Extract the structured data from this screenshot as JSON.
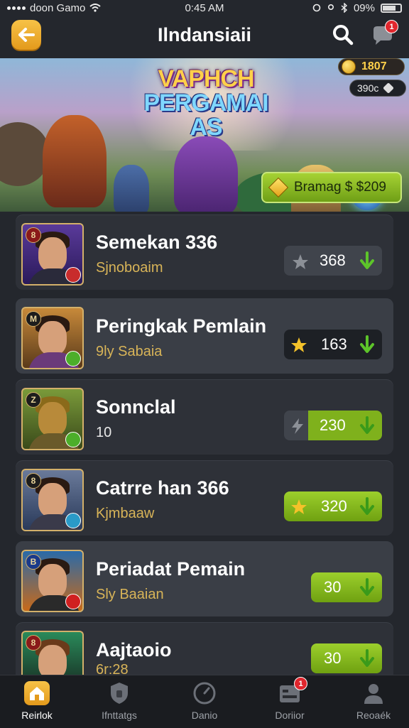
{
  "status": {
    "carrier": "doon Gamo",
    "time": "0:45 AM",
    "battery": "09%"
  },
  "header": {
    "title": "Ilndansiaii",
    "chat_badge": "1"
  },
  "banner": {
    "title_line1": "VAPHCH",
    "title_line2": "PERGAMAI AS",
    "coins": "1807",
    "gems": "390c",
    "buy_label": "Bramag $ $209"
  },
  "list": [
    {
      "rank": "8",
      "name": "Semekan 336",
      "sub": "Sjnoboaim",
      "score": "368",
      "star": "gray-star",
      "style": "gray"
    },
    {
      "rank": "M",
      "name": "Peringkak Pemlain",
      "sub": "9ly Sabaia",
      "score": "163",
      "star": "gold-star",
      "style": "dark"
    },
    {
      "rank": "Z",
      "name": "Sonnclal",
      "sub": "10",
      "score": "230",
      "star": "bolt",
      "style": "green-split"
    },
    {
      "rank": "8",
      "name": "Catrre han 366",
      "sub": "Kjmbaaw",
      "score": "320",
      "star": "gold-star",
      "style": "green"
    },
    {
      "rank": "B",
      "name": "Periadat Pemain",
      "sub": "Sly Baaian",
      "score": "30",
      "star": "none",
      "style": "green"
    },
    {
      "rank": "8",
      "name": "Aajtaoio",
      "sub": "6r:28",
      "score": "30",
      "star": "none",
      "style": "green"
    }
  ],
  "nav": {
    "items": [
      "Reirlok",
      "Ifnttatgs",
      "Danio",
      "Doriior",
      "Reoaék"
    ],
    "badge": "1"
  },
  "colors": {
    "accent_gold": "#d8b458",
    "green": "#7fb11c",
    "badge_red": "#e0262d"
  }
}
